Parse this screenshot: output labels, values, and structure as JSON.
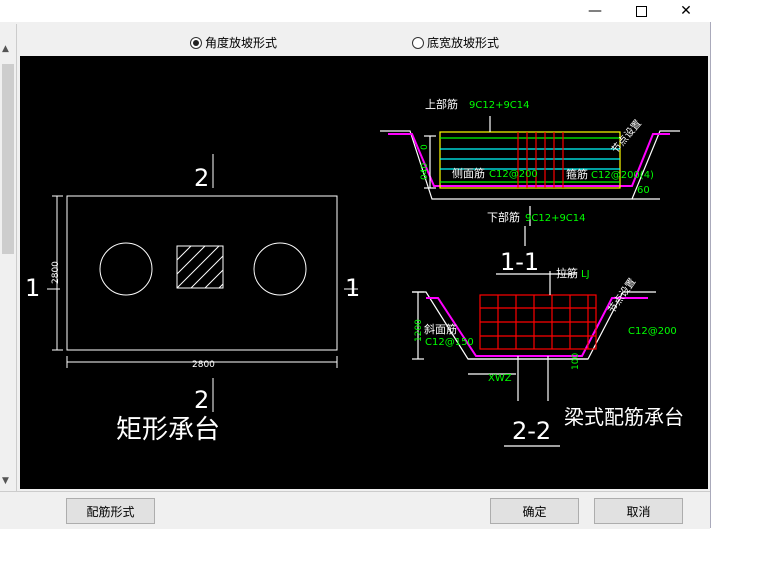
{
  "window": {
    "minimize_icon": "minimize-icon",
    "maximize_icon": "maximize-icon",
    "close_icon": "close-icon"
  },
  "options": {
    "radio_angle": {
      "label": "角度放坡形式",
      "selected": true
    },
    "radio_width": {
      "label": "底宽放坡形式",
      "selected": false
    }
  },
  "drawing": {
    "left": {
      "section_top": "2",
      "section_bottom": "2",
      "section_left": "1",
      "section_right": "1",
      "dim_height": "2800",
      "dim_width": "2800",
      "caption": "矩形承台"
    },
    "section11": {
      "top_rebar_label": "上部筋",
      "top_rebar_value": "9C12+9C14",
      "side_rebar_label": "侧面筋",
      "side_rebar_value": "C12@200",
      "stirrup_label": "箍筋",
      "stirrup_value": "C12@200(4)",
      "bottom_rebar_label": "下部筋",
      "bottom_rebar_value": "9C12+9C14",
      "angle": "60",
      "node_setting": "节点设置",
      "dim_left_top": "0",
      "dim_left_mid": "040",
      "title": "1-1"
    },
    "section22": {
      "tie_label": "拉筋",
      "tie_value": "LJ",
      "slope_rebar_label": "斜面筋",
      "slope_rebar_value": "C12@150",
      "right_value": "C12@200",
      "node_setting": "节点设置",
      "dim_height": "1200",
      "dim_small": "100",
      "xwz": "XWZ",
      "title": "2-2",
      "caption": "梁式配筋承台"
    }
  },
  "buttons": {
    "rebar_form": "配筋形式",
    "ok": "确定",
    "cancel": "取消"
  },
  "colors": {
    "canvas_bg": "#000000",
    "cyan": "#00ffff",
    "green": "#00ff00",
    "red": "#ff0000",
    "magenta": "#ff00ff",
    "yellow": "#ffff00"
  }
}
